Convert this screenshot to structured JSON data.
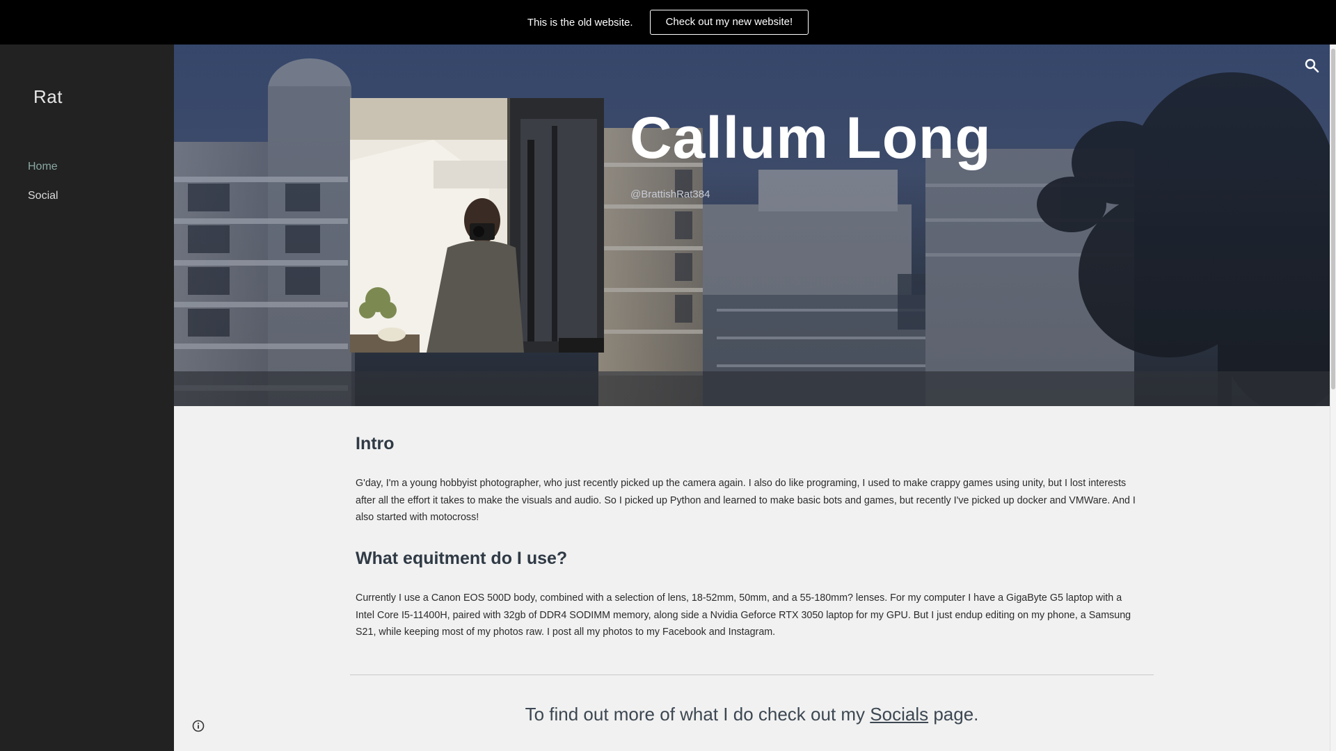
{
  "banner": {
    "text": "This is the old website.",
    "button_label": "Check out my new website!"
  },
  "sidebar": {
    "site_title": "Rat",
    "items": [
      {
        "label": "Home",
        "active": true
      },
      {
        "label": "Social",
        "active": false
      }
    ]
  },
  "hero": {
    "name": "Callum Long",
    "handle": "@BrattishRat384"
  },
  "sections": [
    {
      "heading": "Intro",
      "body": "G'day, I'm a young hobbyist photographer, who just recently picked up the camera again.  I also do like programing, I used to make crappy games using unity, but I lost interests after all the effort it takes to make the visuals and audio. So I picked up Python and learned to make basic bots and games, but recently I've picked up docker and VMWare. And I also started with motocross!"
    },
    {
      "heading": "What equitment do I use?",
      "body": "Currently I use a Canon EOS 500D body, combined with a selection of lens, 18-52mm, 50mm, and a 55-180mm? lenses. For my computer I have a GigaByte G5 laptop with a Intel Core I5-11400H, paired with 32gb of DDR4  SODIMM memory, along side a Nvidia Geforce RTX 3050 laptop for my GPU. But I just endup editing on my phone, a Samsung S21, while keeping most of my photos raw. I post all my photos to my Facebook and Instagram."
    }
  ],
  "cta": {
    "prefix": "To find out more of what I do check out my ",
    "link": "Socials",
    "suffix": " page."
  },
  "icons": {
    "search": "search-icon",
    "info": "info-icon"
  },
  "colors": {
    "banner_bg": "#000000",
    "sidebar_bg": "#222222",
    "nav_active": "#8aa8a4",
    "content_bg": "#f1f1f1",
    "heading": "#2f3a45"
  }
}
